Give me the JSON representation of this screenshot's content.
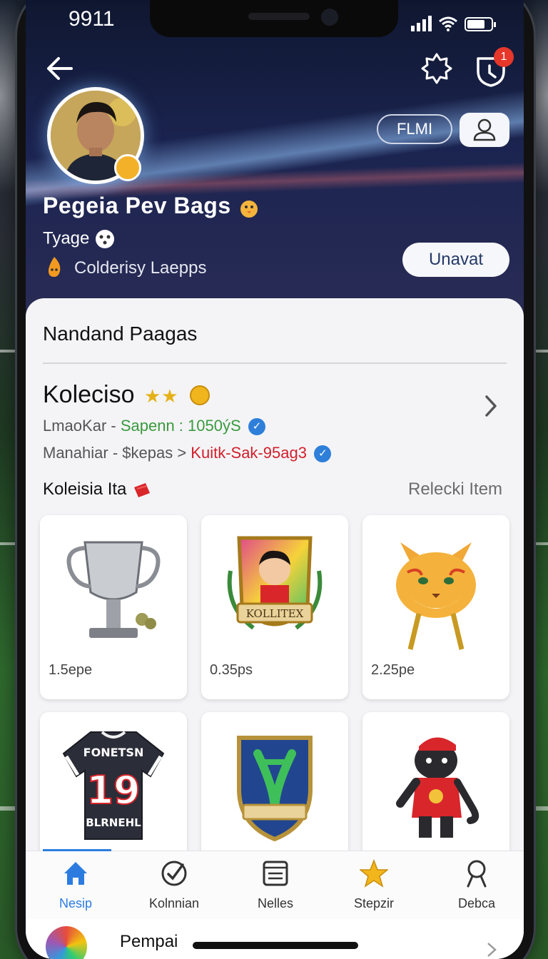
{
  "status_bar": {
    "time": "9911"
  },
  "header": {
    "notification_count": "1",
    "pill_label": "FLMI",
    "action_button": "Unavat"
  },
  "profile": {
    "name": "Pegeia Pev Bags",
    "subtitle": "Tyage",
    "location": "Colderisy Laepps"
  },
  "section": {
    "title": "Nandand Paagas"
  },
  "collection": {
    "title": "Koleciso",
    "line1_label": "LmaoKar - ",
    "line1_value": "Sapenn : 1050ýS",
    "line2_label": "Manahiar - $kepas > ",
    "line2_value": "Kuitk-Sak-95ag3"
  },
  "items": {
    "title": "Koleisia Ita",
    "link": "Relecki Item",
    "list": [
      {
        "name": "trophy",
        "price": "1.5epe"
      },
      {
        "name": "kollitex-badge",
        "price": "0.35ps",
        "badge_text": "KOLLITEX"
      },
      {
        "name": "fox-mascot",
        "price": "2.25pe"
      },
      {
        "name": "jersey",
        "price": "",
        "jersey_top": "FONETSN",
        "jersey_number": "19",
        "jersey_bottom": "BLRNEHL"
      },
      {
        "name": "shield",
        "price": ""
      },
      {
        "name": "mascot",
        "price": ""
      }
    ]
  },
  "tabs": [
    {
      "label": "Nesip",
      "icon": "home-icon",
      "active": true
    },
    {
      "label": "Kolnnian",
      "icon": "check-circle-icon"
    },
    {
      "label": "Nelles",
      "icon": "news-icon"
    },
    {
      "label": "Stepzir",
      "icon": "star-icon"
    },
    {
      "label": "Debca",
      "icon": "search-icon"
    }
  ],
  "mini_player": {
    "title": "Pempai"
  },
  "colors": {
    "accent": "#2c7ce0",
    "header_dark": "#1b2450",
    "badge_red": "#e6372a",
    "green_text": "#3a9a3e",
    "red_text": "#d21f2c"
  }
}
